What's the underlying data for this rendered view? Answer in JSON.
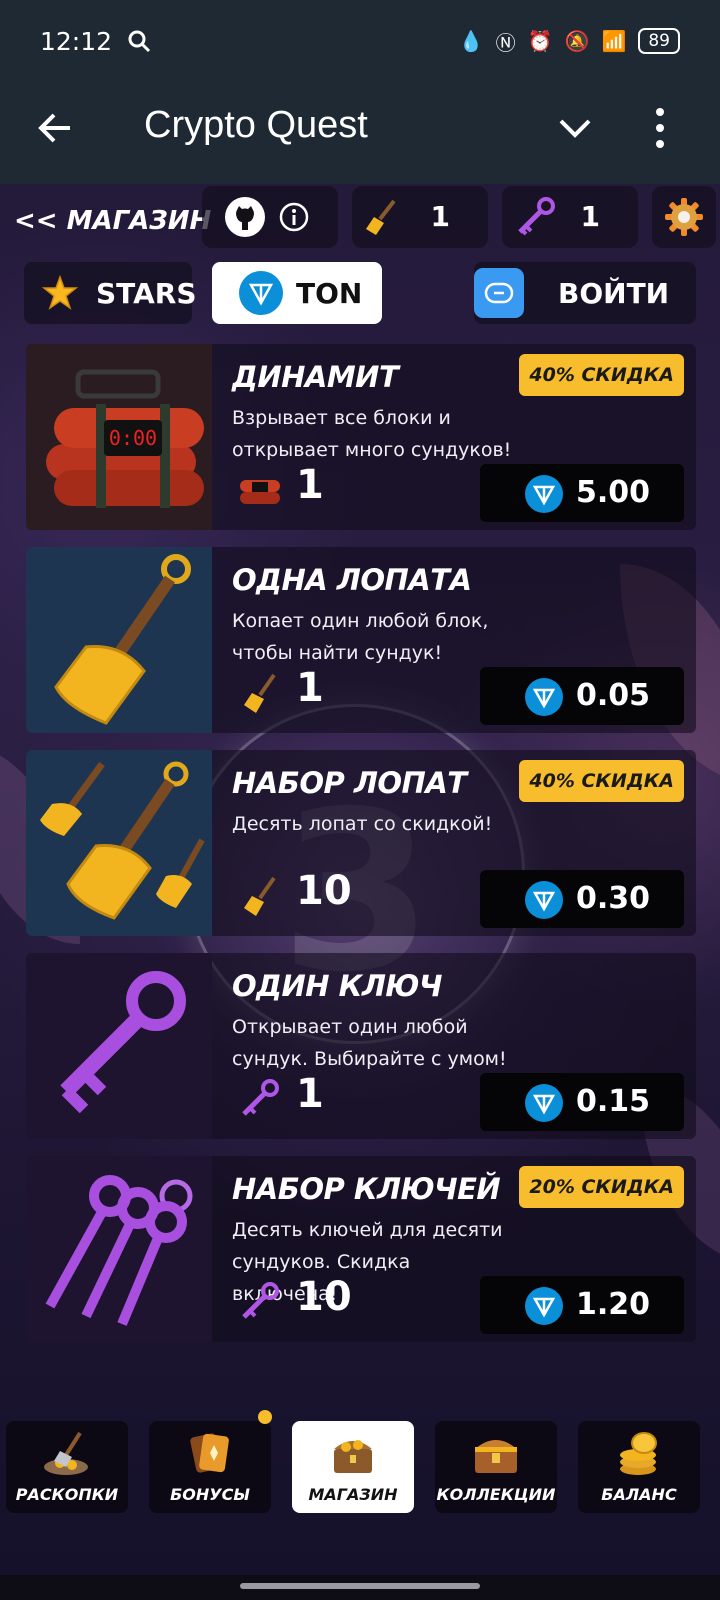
{
  "status": {
    "time": "12:12",
    "battery": "89"
  },
  "appbar": {
    "title": "Crypto Quest"
  },
  "top": {
    "shop_title": "<< МАГАЗИН",
    "shovels": "1",
    "keys": "1"
  },
  "tabs": {
    "stars": "STARS",
    "ton": "TON",
    "login": "ВОЙТИ"
  },
  "items": [
    {
      "name": "ДИНАМИТ",
      "desc": "Взрывает все блоки и открывает много сундуков!",
      "badge": "40% СКИДКА",
      "qty": "1",
      "price": "5.00"
    },
    {
      "name": "ОДНА ЛОПАТА",
      "desc": "Копает один любой блок, чтобы найти сундук!",
      "badge": "",
      "qty": "1",
      "price": "0.05"
    },
    {
      "name": "НАБОР ЛОПАТ",
      "desc": "Десять лопат со скидкой!",
      "badge": "40% СКИДКА",
      "qty": "10",
      "price": "0.30"
    },
    {
      "name": "ОДИН КЛЮЧ",
      "desc": "Открывает один любой сундук. Выбирайте с умом!",
      "badge": "",
      "qty": "1",
      "price": "0.15"
    },
    {
      "name": "НАБОР КЛЮЧЕЙ",
      "desc": "Десять ключей для десяти сундуков. Скидка включена!",
      "badge": "20% СКИДКА",
      "qty": "10",
      "price": "1.20"
    }
  ],
  "nav": [
    {
      "label": "РАСКОПКИ"
    },
    {
      "label": "БОНУСЫ"
    },
    {
      "label": "МАГАЗИН"
    },
    {
      "label": "КОЛЛЕКЦИИ"
    },
    {
      "label": "БАЛАНС"
    }
  ],
  "colors": {
    "accent_badge": "#f7bd2c",
    "ton_blue": "#0a8fd8",
    "active_tab": "#ffffff"
  },
  "icons": [
    "search-icon",
    "back-arrow-icon",
    "chevron-down-icon",
    "more-vert-icon",
    "github-icon",
    "info-icon",
    "shovel-icon",
    "key-icon",
    "gear-icon",
    "star-icon",
    "ton-icon",
    "wallet-icon",
    "dynamite-icon",
    "chest-icon",
    "cards-icon",
    "coins-icon"
  ]
}
